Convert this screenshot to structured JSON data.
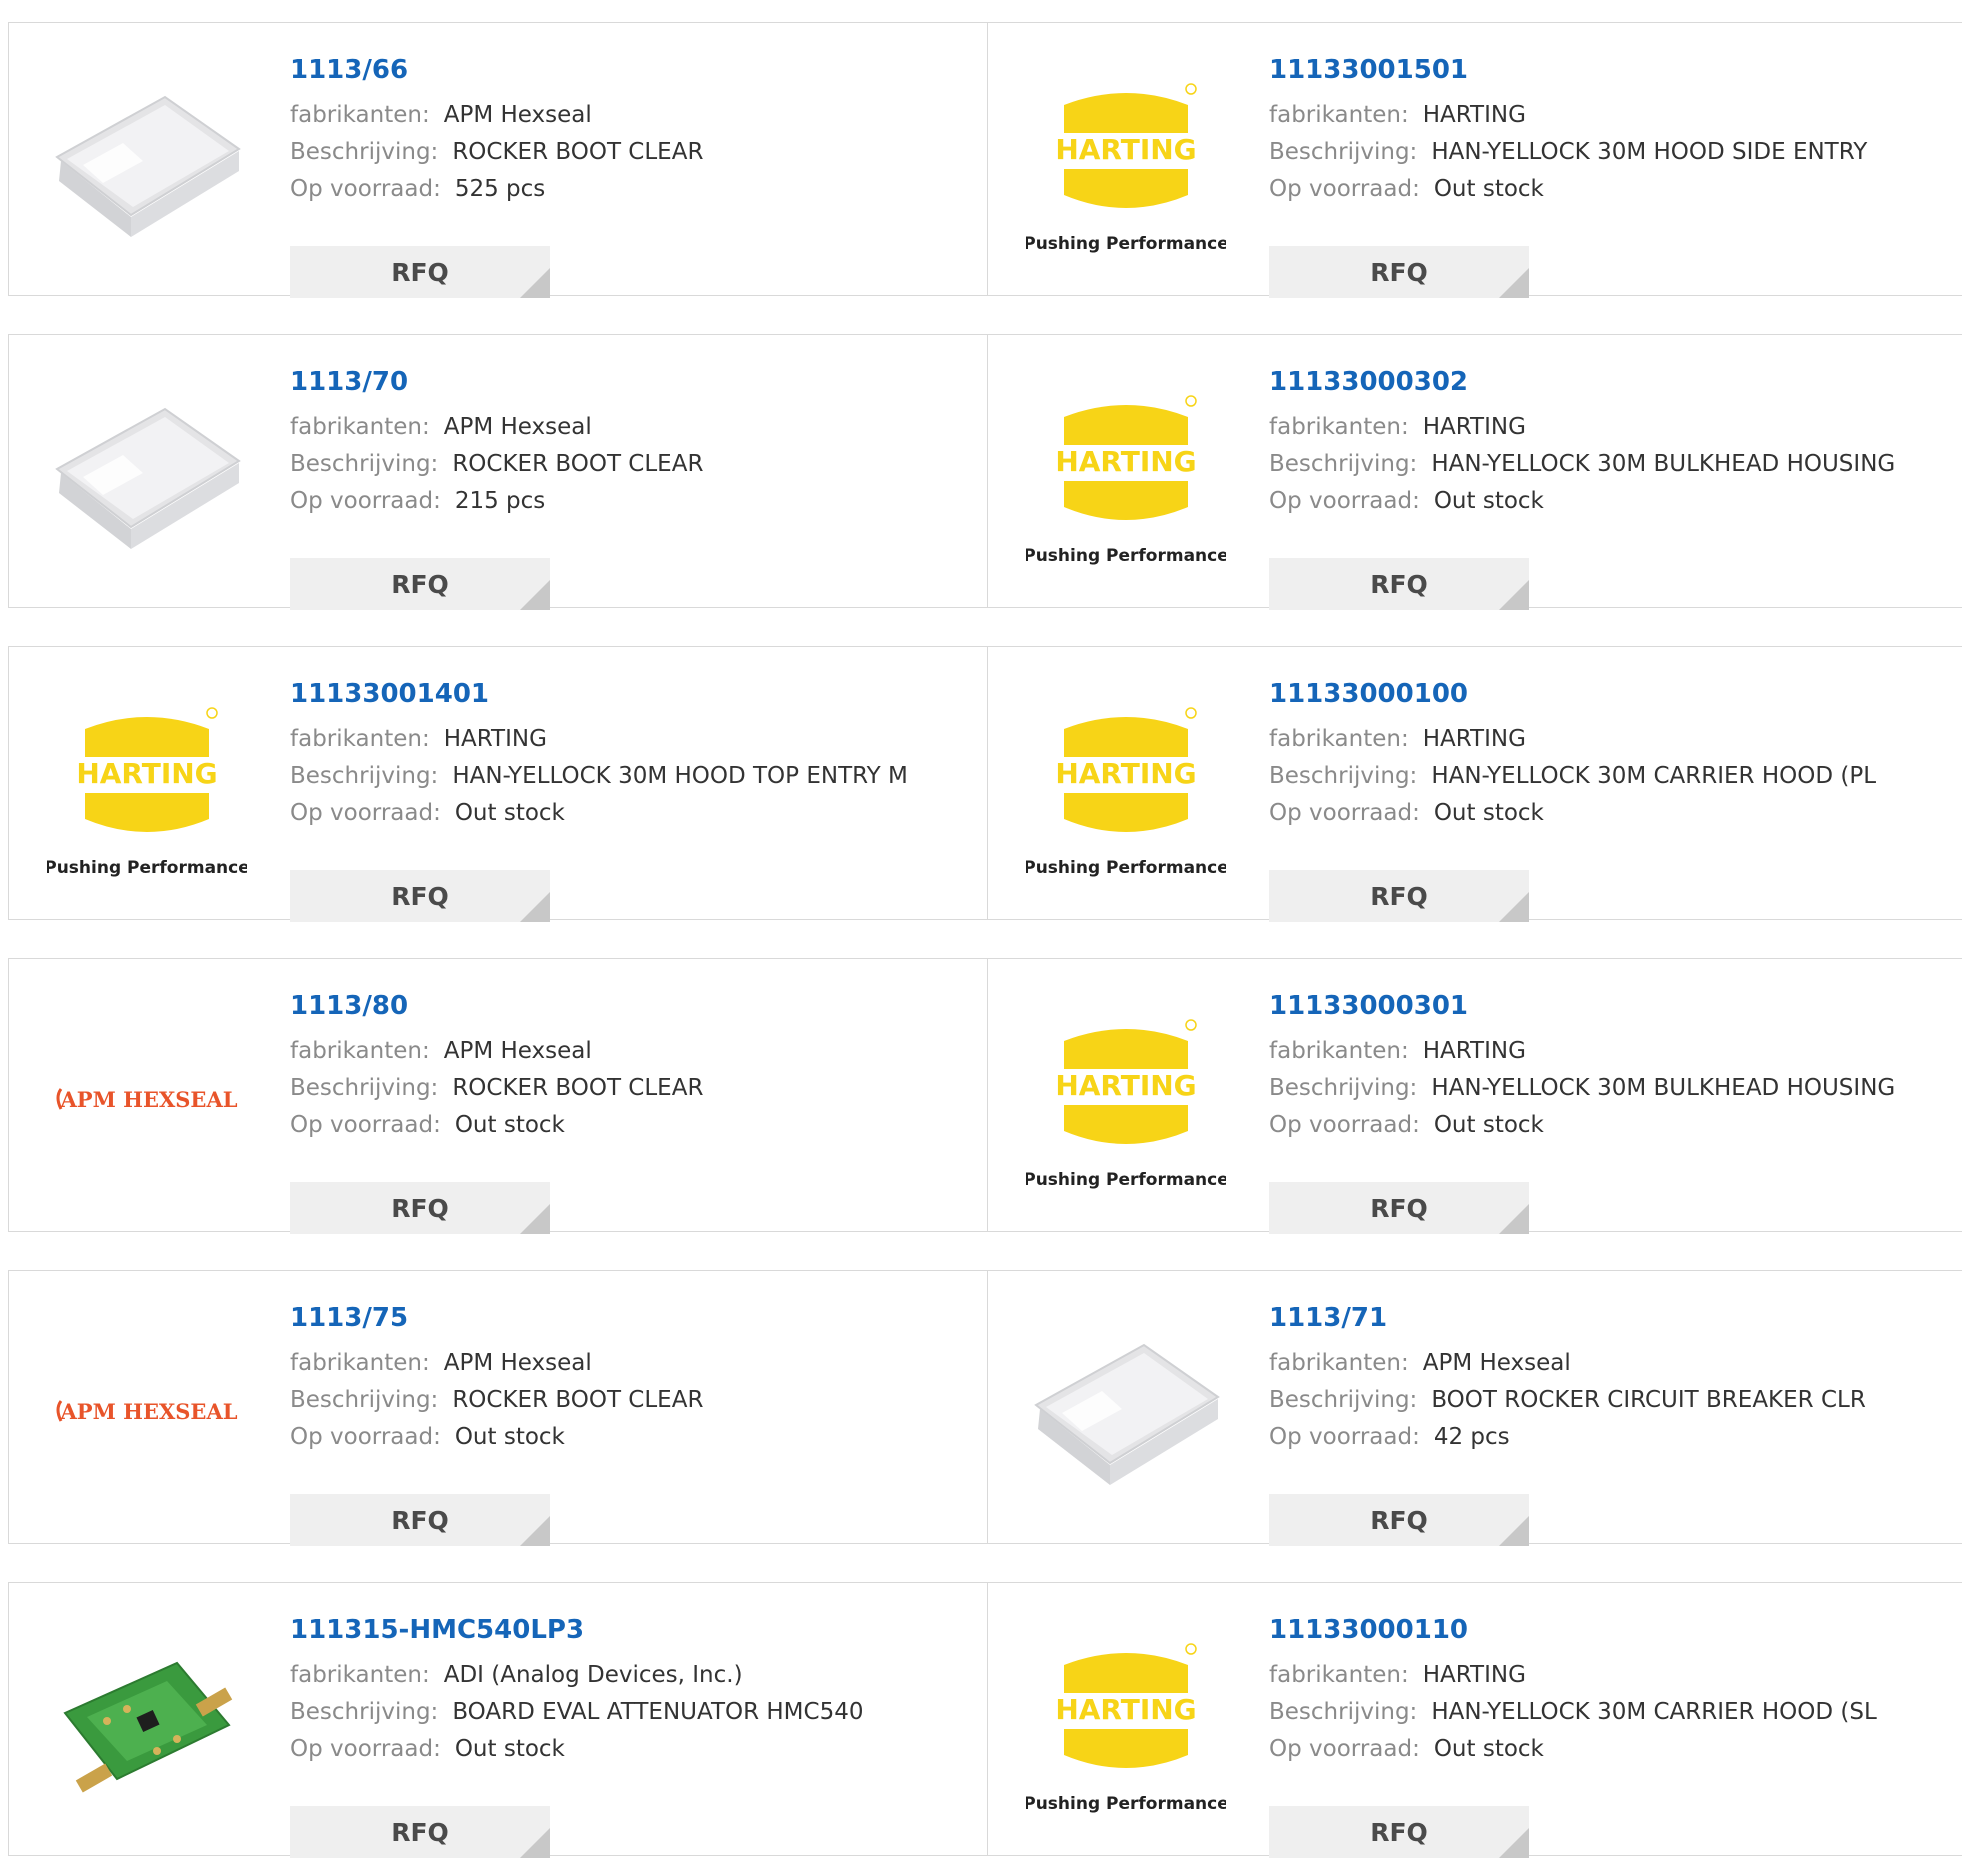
{
  "labels": {
    "manufacturer": "fabrikanten:",
    "description": "Beschrijving:",
    "stock": "Op voorraad:",
    "rfq": "RFQ"
  },
  "logos": {
    "harting_text": "HARTING",
    "harting_tagline": "Pushing Performance",
    "apm_text": "APM HEXSEAL"
  },
  "colors": {
    "link": "#1565b8",
    "harting_yellow": "#f7d417",
    "apm_orange": "#e8542a",
    "rfq_bg": "#efefef"
  },
  "rows": [
    [
      {
        "part": "1113/66",
        "manufacturer": "APM Hexseal",
        "description": "ROCKER BOOT CLEAR",
        "stock": "525 pcs",
        "image": "rocker-boot-photo"
      },
      {
        "part": "11133001501",
        "manufacturer": "HARTING",
        "description": "HAN-YELLOCK 30M HOOD SIDE ENTRY",
        "stock": "Out stock",
        "image": "harting-logo"
      }
    ],
    [
      {
        "part": "1113/70",
        "manufacturer": "APM Hexseal",
        "description": "ROCKER BOOT CLEAR",
        "stock": "215 pcs",
        "image": "rocker-boot-photo"
      },
      {
        "part": "11133000302",
        "manufacturer": "HARTING",
        "description": "HAN-YELLOCK 30M BULKHEAD HOUSING",
        "stock": "Out stock",
        "image": "harting-logo"
      }
    ],
    [
      {
        "part": "11133001401",
        "manufacturer": "HARTING",
        "description": "HAN-YELLOCK 30M HOOD TOP ENTRY M",
        "stock": "Out stock",
        "image": "harting-logo"
      },
      {
        "part": "11133000100",
        "manufacturer": "HARTING",
        "description": "HAN-YELLOCK 30M CARRIER HOOD (PL",
        "stock": "Out stock",
        "image": "harting-logo"
      }
    ],
    [
      {
        "part": "1113/80",
        "manufacturer": "APM Hexseal",
        "description": "ROCKER BOOT CLEAR",
        "stock": "Out stock",
        "image": "apm-hexseal-logo"
      },
      {
        "part": "11133000301",
        "manufacturer": "HARTING",
        "description": "HAN-YELLOCK 30M BULKHEAD HOUSING",
        "stock": "Out stock",
        "image": "harting-logo"
      }
    ],
    [
      {
        "part": "1113/75",
        "manufacturer": "APM Hexseal",
        "description": "ROCKER BOOT CLEAR",
        "stock": "Out stock",
        "image": "apm-hexseal-logo"
      },
      {
        "part": "1113/71",
        "manufacturer": "APM Hexseal",
        "description": "BOOT ROCKER CIRCUIT BREAKER CLR",
        "stock": "42 pcs",
        "image": "rocker-boot-photo"
      }
    ],
    [
      {
        "part": "111315-HMC540LP3",
        "manufacturer": "ADI (Analog Devices, Inc.)",
        "description": "BOARD EVAL ATTENUATOR HMC540",
        "stock": "Out stock",
        "image": "eval-board-photo"
      },
      {
        "part": "11133000110",
        "manufacturer": "HARTING",
        "description": "HAN-YELLOCK 30M CARRIER HOOD (SL",
        "stock": "Out stock",
        "image": "harting-logo"
      }
    ]
  ]
}
